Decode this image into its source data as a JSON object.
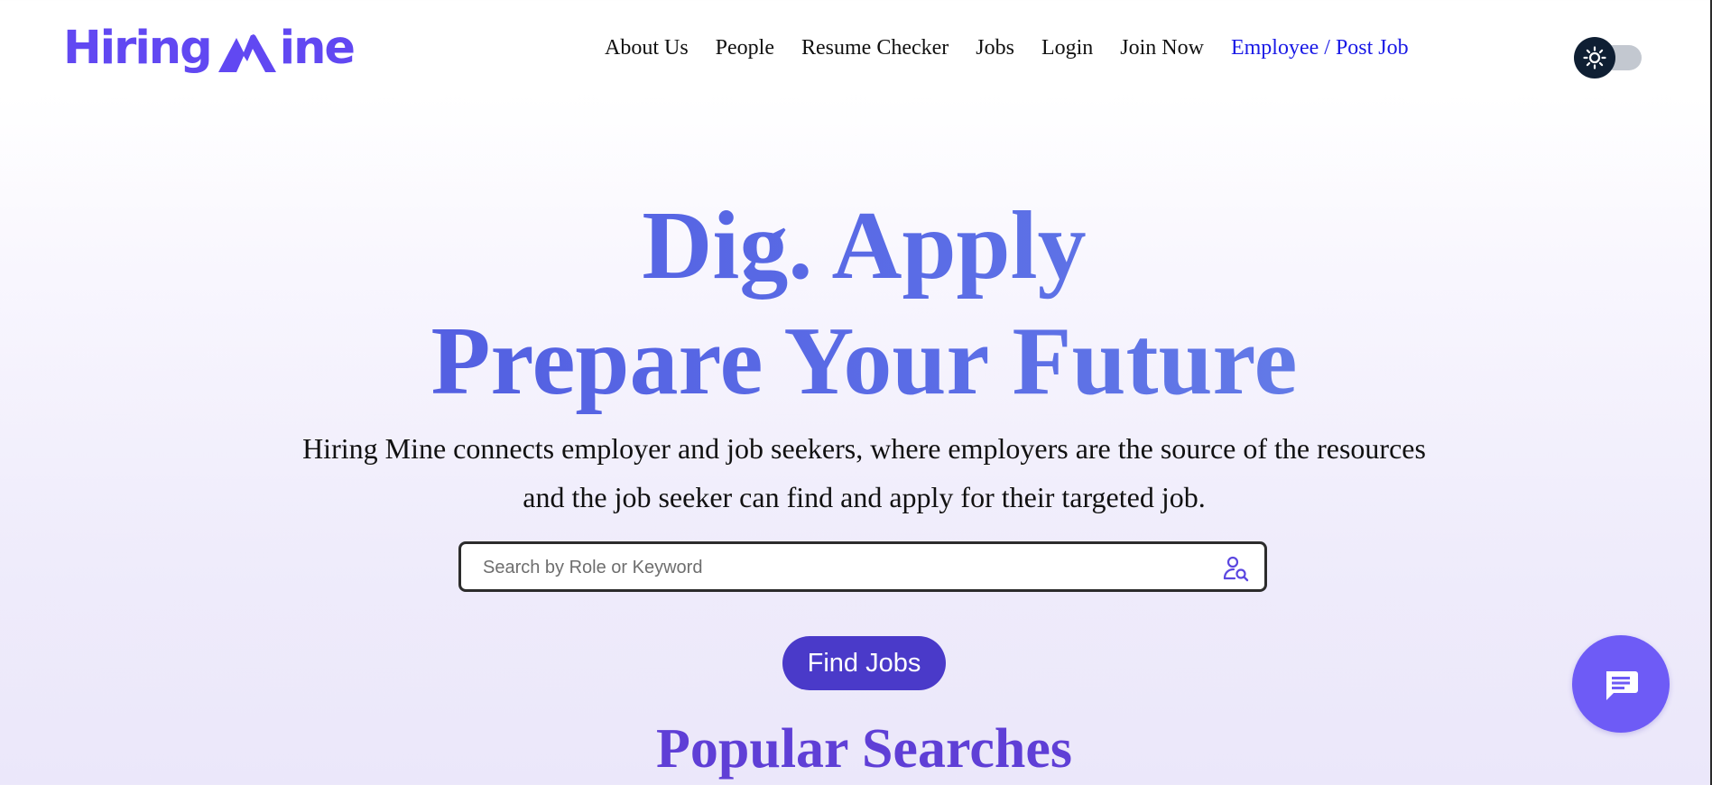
{
  "header": {
    "logo_text_left": "Hiring",
    "logo_text_right": "ine",
    "nav": [
      {
        "label": "About Us"
      },
      {
        "label": "People"
      },
      {
        "label": "Resume Checker"
      },
      {
        "label": "Jobs"
      },
      {
        "label": "Login"
      },
      {
        "label": "Join Now"
      },
      {
        "label": "Employee / Post Job"
      }
    ],
    "theme_toggle_icon": "sun-icon"
  },
  "hero": {
    "title_line1": "Dig. Apply",
    "title_line2": "Prepare Your Future",
    "description": "Hiring Mine connects employer and job seekers, where employers are the source of the resources and the job seeker can find and apply for their targeted job.",
    "search": {
      "placeholder": "Search by Role or Keyword",
      "icon": "user-search-icon"
    },
    "find_button": "Find Jobs",
    "popular_heading": "Popular Searches"
  },
  "chat": {
    "icon": "chat-icon"
  },
  "colors": {
    "brand": "#6148f2",
    "title": "#5a6fe6",
    "button": "#4a3ac9",
    "chat": "#6e5bf6",
    "link": "#1a1ae6"
  }
}
